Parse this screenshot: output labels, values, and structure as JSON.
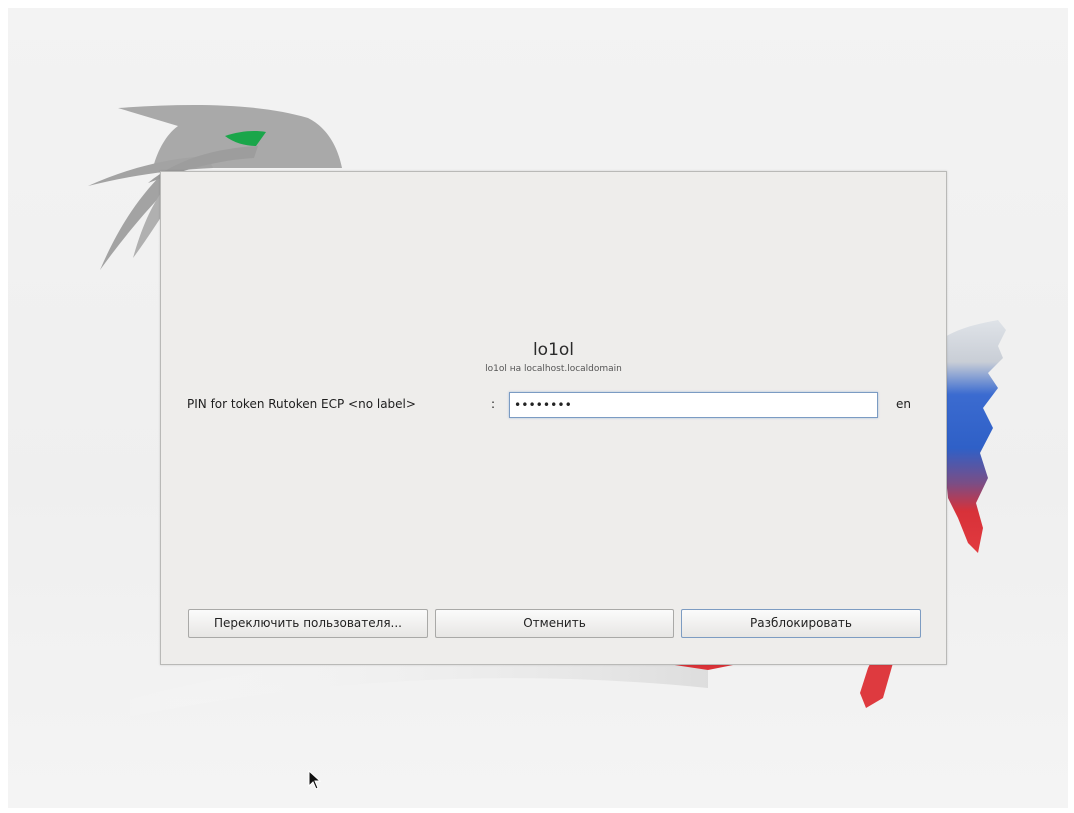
{
  "dialog": {
    "user_name": "lo1ol",
    "user_host": "lo1ol на localhost.localdomain",
    "pin_label": "PIN for token Rutoken ECP <no label>",
    "pin_separator": ":",
    "pin_value": "••••••••",
    "keyboard_layout": "en",
    "buttons": {
      "switch_user": "Переключить пользователя...",
      "cancel": "Отменить",
      "unlock": "Разблокировать"
    }
  },
  "colors": {
    "dialog_bg": "#eeedeb",
    "focus_border": "#7b9bc3",
    "eagle_gray": "#a6a6a6",
    "eagle_eye": "#1aa64a",
    "flag_white": "#e4e7ea",
    "flag_blue": "#2f63c9",
    "flag_red": "#d63139"
  },
  "icons": [
    "eagle-emblem",
    "russia-map-flag",
    "mouse-pointer-icon"
  ]
}
